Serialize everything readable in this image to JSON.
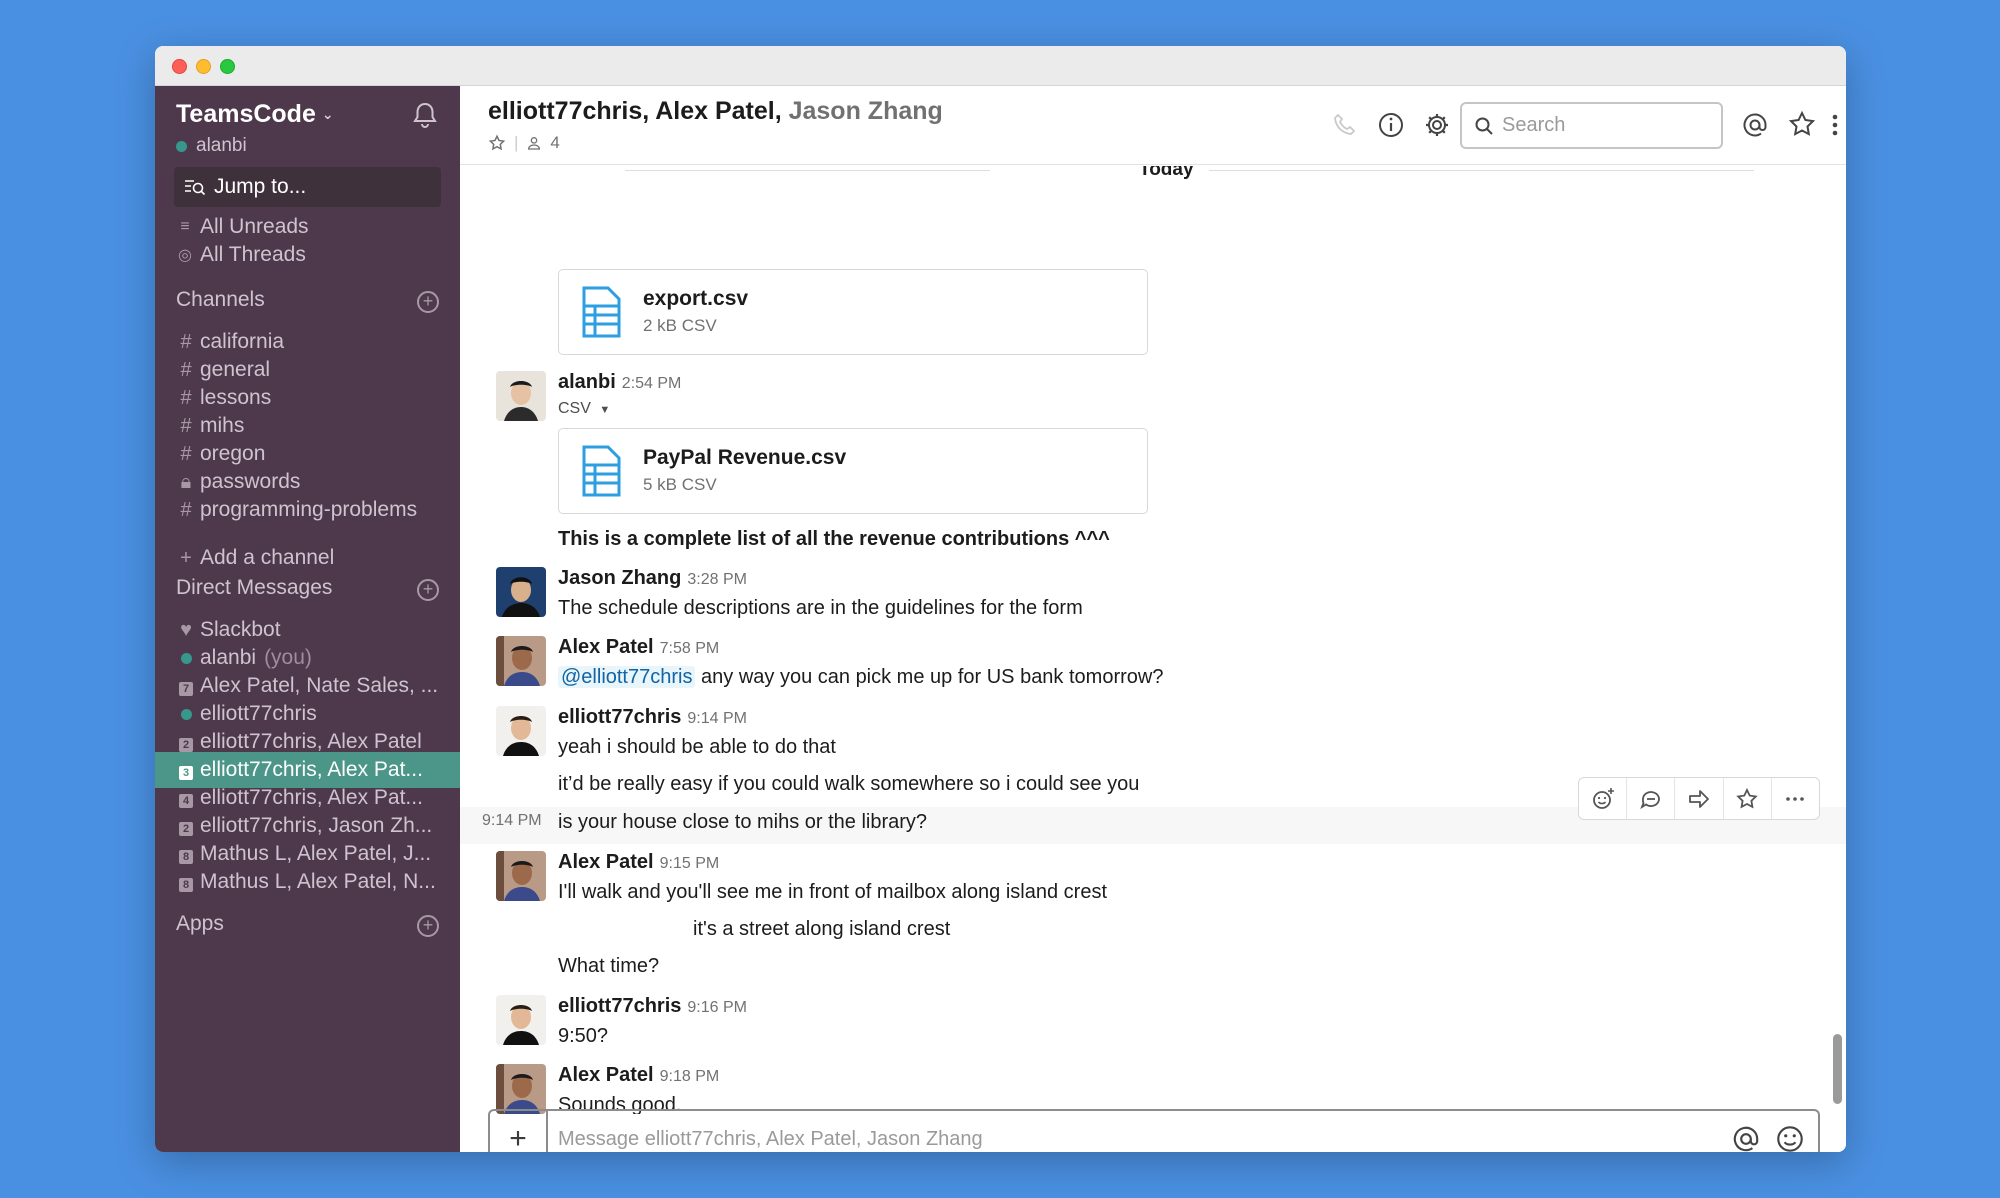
{
  "sidebar": {
    "team_name": "TeamsCode",
    "user": "alanbi",
    "jump_to": "Jump to...",
    "links": [
      {
        "label": "All Unreads",
        "icon": "list-icon"
      },
      {
        "label": "All Threads",
        "icon": "thread-icon"
      }
    ],
    "channels_heading": "Channels",
    "channels": [
      "california",
      "general",
      "lessons",
      "mihs",
      "oregon",
      "passwords",
      "programming-problems"
    ],
    "add_channel": "Add a channel",
    "dm_heading": "Direct Messages",
    "dms": [
      {
        "label": "Slackbot",
        "prefix": "heart",
        "badge": ""
      },
      {
        "label": "alanbi",
        "suffix": "(you)",
        "prefix": "online",
        "badge": ""
      },
      {
        "label": "Alex Patel, Nate Sales, ...",
        "prefix": "badge",
        "badge": "7"
      },
      {
        "label": "elliott77chris",
        "prefix": "online",
        "badge": ""
      },
      {
        "label": "elliott77chris, Alex Patel",
        "prefix": "badge",
        "badge": "2"
      },
      {
        "label": "elliott77chris, Alex Pat...",
        "prefix": "badge",
        "badge": "3",
        "active": true
      },
      {
        "label": "elliott77chris, Alex Pat...",
        "prefix": "badge",
        "badge": "4"
      },
      {
        "label": "elliott77chris, Jason Zh...",
        "prefix": "badge",
        "badge": "2"
      },
      {
        "label": "Mathus L, Alex Patel, J...",
        "prefix": "badge",
        "badge": "8"
      },
      {
        "label": "Mathus L, Alex Patel, N...",
        "prefix": "badge",
        "badge": "8"
      }
    ],
    "apps_heading": "Apps"
  },
  "header": {
    "title_main": "elliott77chris, Alex Patel,",
    "title_dim": "Jason Zhang",
    "member_count": "4",
    "search_placeholder": "Search"
  },
  "messages": {
    "day_label": "Today",
    "file1": {
      "name": "export.csv",
      "size": "2 kB CSV"
    },
    "m1": {
      "author": "alanbi",
      "time": "2:54 PM",
      "csv": "CSV",
      "file_name": "PayPal Revenue.csv",
      "file_size": "5 kB CSV",
      "text": "This is a complete list of all the revenue contributions ^^^"
    },
    "m2": {
      "author": "Jason Zhang",
      "time": "3:28 PM",
      "text": "The schedule descriptions are in the guidelines for the form"
    },
    "m3": {
      "author": "Alex Patel",
      "time": "7:58 PM",
      "mention": "@elliott77chris",
      "text": "any way you can pick me up for US bank tomorrow?"
    },
    "m4": {
      "author": "elliott77chris",
      "time": "9:14 PM",
      "lines": [
        "yeah i should be able to do that",
        "it’d be really easy if you could walk somewhere so i could see you",
        "is your house close to mihs or the library?"
      ],
      "hover_time": "9:14 PM"
    },
    "m5": {
      "author": "Alex Patel",
      "time": "9:15 PM",
      "lines": [
        "I'll walk and you'll see me in front of mailbox along island crest",
        "it's a street along island crest",
        "What time?"
      ]
    },
    "m6": {
      "author": "elliott77chris",
      "time": "9:16 PM",
      "text": "9:50?"
    },
    "m7": {
      "author": "Alex Patel",
      "time": "9:18 PM",
      "text": "Sounds good."
    }
  },
  "composer": {
    "placeholder": "Message elliott77chris, Alex Patel, Jason Zhang"
  },
  "colors": {
    "sidebar_bg": "#4d394b",
    "active_item": "#4c9689",
    "presence": "#38978d",
    "file_icon": "#2d9ee0"
  }
}
